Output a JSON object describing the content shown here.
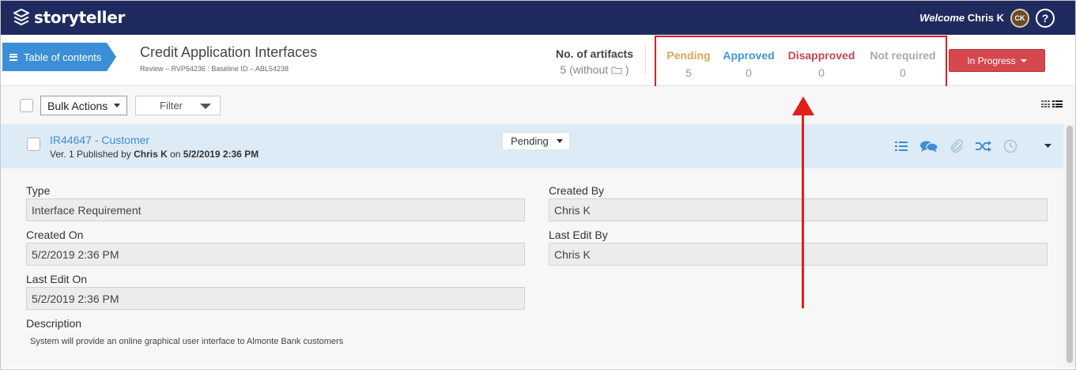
{
  "app": {
    "logo_text": "storyteller",
    "welcome_prefix": "Welcome",
    "user_name": "Chris K",
    "avatar_initials": "CK",
    "help_label": "?"
  },
  "header": {
    "toc_label": "Table of contents",
    "title": "Credit Application Interfaces",
    "subtitle": "Review – RVP54236 : Baseline ID – ABL54238",
    "artifacts_label": "No. of artifacts",
    "artifacts_value": "5 (without",
    "artifacts_close": ")",
    "counts": [
      {
        "label": "Pending",
        "value": "5",
        "color": "#d9a654"
      },
      {
        "label": "Approved",
        "value": "0",
        "color": "#3f96d4"
      },
      {
        "label": "Disapproved",
        "value": "0",
        "color": "#c4474e"
      },
      {
        "label": "Not required",
        "value": "0",
        "color": "#a8a8a8"
      }
    ],
    "status_button": "In Progress"
  },
  "toolbar": {
    "bulk_actions": "Bulk Actions",
    "filter": "Filter"
  },
  "artifact": {
    "title": "IR44647 - Customer",
    "meta_version": "Ver. 1 Published by ",
    "meta_author": "Chris K",
    "meta_on": " on ",
    "meta_date": "5/2/2019 2:36 PM",
    "status": "Pending",
    "icons": [
      "list-icon",
      "comments-icon",
      "attachment-icon",
      "shuffle-icon",
      "clock-icon",
      "chevron-down-icon"
    ]
  },
  "details": {
    "type_label": "Type",
    "type_value": "Interface Requirement",
    "created_on_label": "Created On",
    "created_on_value": "5/2/2019 2:36 PM",
    "last_edit_on_label": "Last Edit On",
    "last_edit_on_value": "5/2/2019 2:36 PM",
    "created_by_label": "Created By",
    "created_by_value": "Chris K",
    "last_edit_by_label": "Last Edit By",
    "last_edit_by_value": "Chris K",
    "description_label": "Description",
    "description_value": "System will provide an online graphical user interface to Almonte Bank customers"
  },
  "colors": {
    "topbar": "#1f2b5e",
    "accent": "#3b8fd6",
    "status_red": "#d6474e",
    "annotation": "#e21d1d"
  }
}
